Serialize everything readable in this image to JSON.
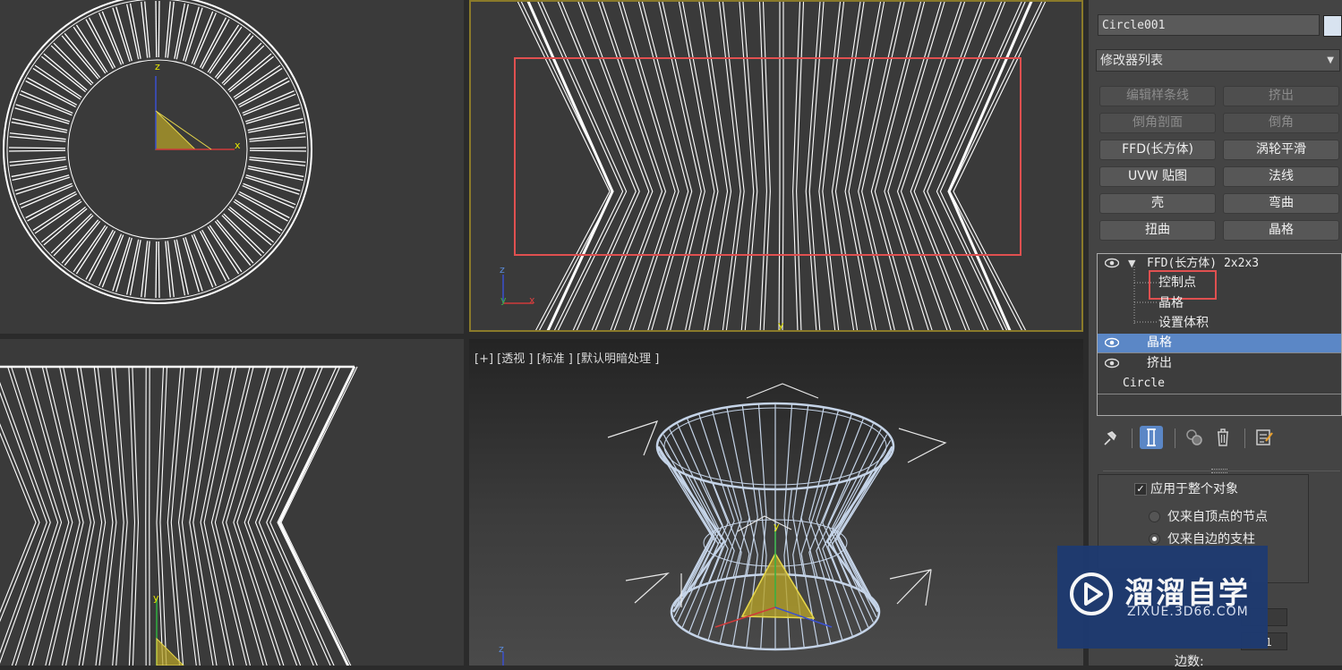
{
  "viewports": {
    "perspective_label": "[+] [透视 ] [标准 ] [默认明暗处理 ]"
  },
  "axes": {
    "x": "x",
    "y": "y",
    "z": "z"
  },
  "panel": {
    "object_name": "Circle001",
    "object_color": "#d8e3f0",
    "modifier_list_label": "修改器列表",
    "modifier_buttons": [
      {
        "label": "编辑样条线",
        "enabled": false
      },
      {
        "label": "挤出",
        "enabled": false
      },
      {
        "label": "倒角剖面",
        "enabled": false
      },
      {
        "label": "倒角",
        "enabled": false
      },
      {
        "label": "FFD(长方体)",
        "enabled": true
      },
      {
        "label": "涡轮平滑",
        "enabled": true
      },
      {
        "label": "UVW 贴图",
        "enabled": true
      },
      {
        "label": "法线",
        "enabled": true
      },
      {
        "label": "壳",
        "enabled": true
      },
      {
        "label": "弯曲",
        "enabled": true
      },
      {
        "label": "扭曲",
        "enabled": true
      },
      {
        "label": "晶格",
        "enabled": true
      }
    ],
    "stack": [
      {
        "label": "FFD(长方体) 2x2x3",
        "eye": true,
        "expanded": true
      },
      {
        "label": "控制点",
        "sub": true
      },
      {
        "label": "晶格",
        "sub": true
      },
      {
        "label": "设置体积",
        "sub": true
      },
      {
        "label": "晶格",
        "eye": true,
        "selected": true
      },
      {
        "label": "挤出",
        "eye": true
      },
      {
        "label": "Circle"
      }
    ],
    "toolbar_icons": [
      "pin-stack-icon",
      "show-end-result-icon",
      "make-unique-icon",
      "remove-modifier-icon",
      "configure-sets-icon"
    ],
    "params": {
      "apply_whole": "应用于整个对象",
      "apply_whole_checked": true,
      "radio_vertex": "仅来自顶点的节点",
      "radio_edge": "仅来自边的支柱",
      "radio_selected": "edge",
      "segments_label": "边数:",
      "segments_value": "1"
    }
  },
  "watermark": {
    "title": "溜溜自学",
    "subtitle": "ZIXUE.3D66.COM"
  },
  "colors": {
    "highlight": "#e05050",
    "selection": "#5b87c6",
    "wire": "#ffffff",
    "wire_persp": "#c5d4e8",
    "gizmo": "#e8d84a"
  }
}
